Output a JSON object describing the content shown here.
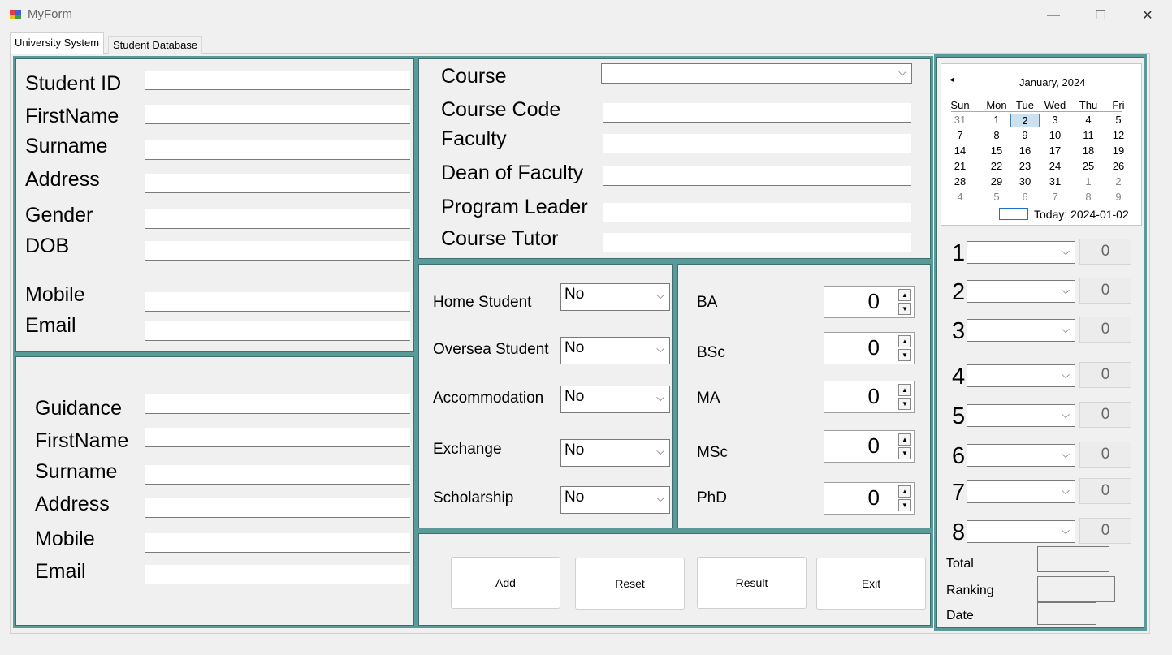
{
  "window": {
    "title": "MyForm",
    "minimize": "—",
    "maximize": "☐",
    "close": "✕"
  },
  "tabs": [
    {
      "label": "University System"
    },
    {
      "label": "Student Database"
    }
  ],
  "student": {
    "labels": [
      "Student ID",
      "FirstName",
      "Surname",
      "Address",
      "Gender",
      "DOB",
      "Mobile",
      "Email"
    ]
  },
  "guidance": {
    "labels": [
      "Guidance",
      "FirstName",
      "Surname",
      "Address",
      "Mobile",
      "Email"
    ]
  },
  "course": {
    "labels": [
      "Course",
      "Course Code",
      "Faculty",
      "Dean of Faculty",
      "Program Leader",
      "Course Tutor"
    ]
  },
  "status": {
    "items": [
      {
        "label": "Home Student",
        "value": "No"
      },
      {
        "label": "Oversea Student",
        "value": "No"
      },
      {
        "label": "Accommodation",
        "value": "No"
      },
      {
        "label": "Exchange",
        "value": "No"
      },
      {
        "label": "Scholarship",
        "value": "No"
      }
    ]
  },
  "degrees": {
    "items": [
      {
        "label": "BA",
        "value": "0"
      },
      {
        "label": "BSc",
        "value": "0"
      },
      {
        "label": "MA",
        "value": "0"
      },
      {
        "label": "MSc",
        "value": "0"
      },
      {
        "label": "PhD",
        "value": "0"
      }
    ]
  },
  "actions": {
    "add": "Add",
    "reset": "Reset",
    "result": "Result",
    "exit": "Exit"
  },
  "calendar": {
    "month_label": "January, 2024",
    "prev_icon": "◂",
    "day_headers": [
      "Sun",
      "Mon",
      "Tue",
      "Wed",
      "Thu",
      "Fri"
    ],
    "weeks": [
      [
        "31",
        "1",
        "2",
        "3",
        "4",
        "5"
      ],
      [
        "7",
        "8",
        "9",
        "10",
        "11",
        "12"
      ],
      [
        "14",
        "15",
        "16",
        "17",
        "18",
        "19"
      ],
      [
        "21",
        "22",
        "23",
        "24",
        "25",
        "26"
      ],
      [
        "28",
        "29",
        "30",
        "31",
        "1",
        "2"
      ],
      [
        "4",
        "5",
        "6",
        "7",
        "8",
        "9"
      ]
    ],
    "today_label": "Today: 2024-01-02"
  },
  "modules": {
    "items": [
      {
        "number": "1",
        "score": "0"
      },
      {
        "number": "2",
        "score": "0"
      },
      {
        "number": "3",
        "score": "0"
      },
      {
        "number": "4",
        "score": "0"
      },
      {
        "number": "5",
        "score": "0"
      },
      {
        "number": "6",
        "score": "0"
      },
      {
        "number": "7",
        "score": "0"
      },
      {
        "number": "8",
        "score": "0"
      }
    ]
  },
  "summary": {
    "total": "Total",
    "ranking": "Ranking",
    "date": "Date"
  },
  "colors": {
    "group_border": "#5a9a99",
    "background": "#f0f0f0"
  }
}
